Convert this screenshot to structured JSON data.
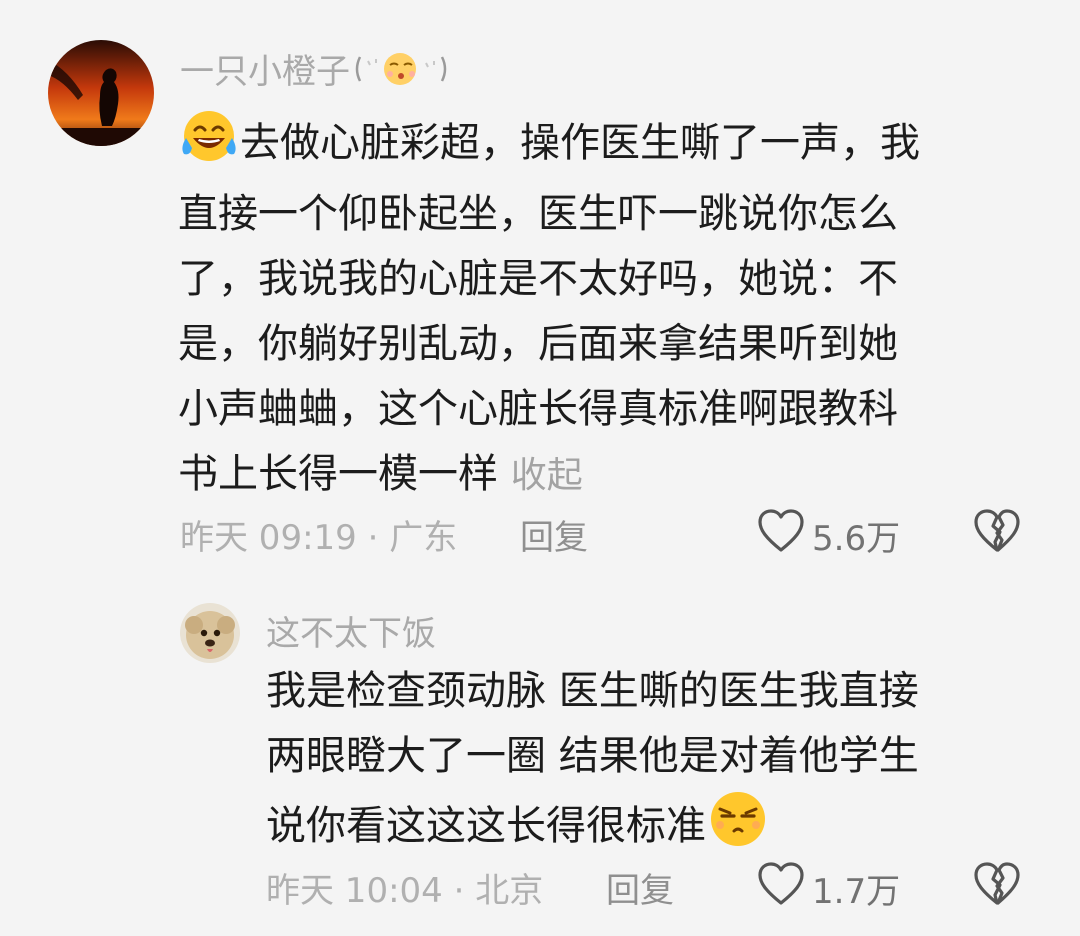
{
  "comments": [
    {
      "username": "一只小橙子",
      "lines": [
        "去做心脏彩超，操作医生嘶了一声，我",
        "直接一个仰卧起坐，医生吓一跳说你怎么",
        "了，我说我的心脏是不太好吗，她说：不",
        "是，你躺好别乱动，后面来拿结果听到她",
        "小声蛐蛐，这个心脏长得真标准啊跟教科",
        "书上长得一模一样"
      ],
      "collapse_label": "收起",
      "time": "昨天 09:19",
      "location": "广东",
      "meta_separator": " · ",
      "reply_label": "回复",
      "like_count": "5.6万",
      "leading_emoji": "laugh-cry-emoji"
    },
    {
      "username": "这不太下饭",
      "lines": [
        "我是检查颈动脉 医生嘶的医生我直接",
        "两眼瞪大了一圈 结果他是对着他学生",
        "说你看这这这长得很标准"
      ],
      "time": "昨天 10:04",
      "location": "北京",
      "meta_separator": " · ",
      "reply_label": "回复",
      "like_count": "1.7万",
      "trailing_emoji": "unamused-emoji"
    }
  ],
  "colors": {
    "background": "#f4f4f4",
    "text": "#1c1c1c",
    "muted": "#a9a9a9",
    "emoji_yellow": "#ffc72c"
  }
}
